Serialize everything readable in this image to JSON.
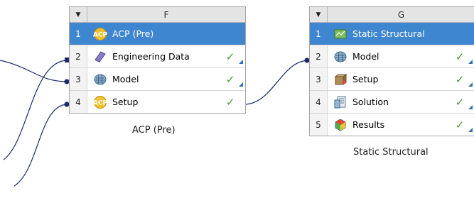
{
  "systems": [
    {
      "letter": "F",
      "caption": "ACP (Pre)",
      "rows": [
        {
          "num": "1",
          "label": "ACP (Pre)",
          "icon": "acp-icon",
          "check": "",
          "selected": true
        },
        {
          "num": "2",
          "label": "Engineering Data",
          "icon": "engineering-data-icon",
          "check": "✓"
        },
        {
          "num": "3",
          "label": "Model",
          "icon": "model-icon",
          "check": "✓"
        },
        {
          "num": "4",
          "label": "Setup",
          "icon": "acp-setup-icon",
          "check": "✓"
        }
      ]
    },
    {
      "letter": "G",
      "caption": "Static Structural",
      "rows": [
        {
          "num": "1",
          "label": "Static Structural",
          "icon": "static-structural-icon",
          "check": "",
          "selected": true
        },
        {
          "num": "2",
          "label": "Model",
          "icon": "model-icon",
          "check": "✓"
        },
        {
          "num": "3",
          "label": "Setup",
          "icon": "setup-icon",
          "check": "✓"
        },
        {
          "num": "4",
          "label": "Solution",
          "icon": "solution-icon",
          "check": "✓"
        },
        {
          "num": "5",
          "label": "Results",
          "icon": "results-icon",
          "check": "✓"
        }
      ]
    }
  ],
  "colors": {
    "selected": "#3f86d0",
    "connector": "#1c2a6b",
    "check": "#4a9a3a"
  }
}
